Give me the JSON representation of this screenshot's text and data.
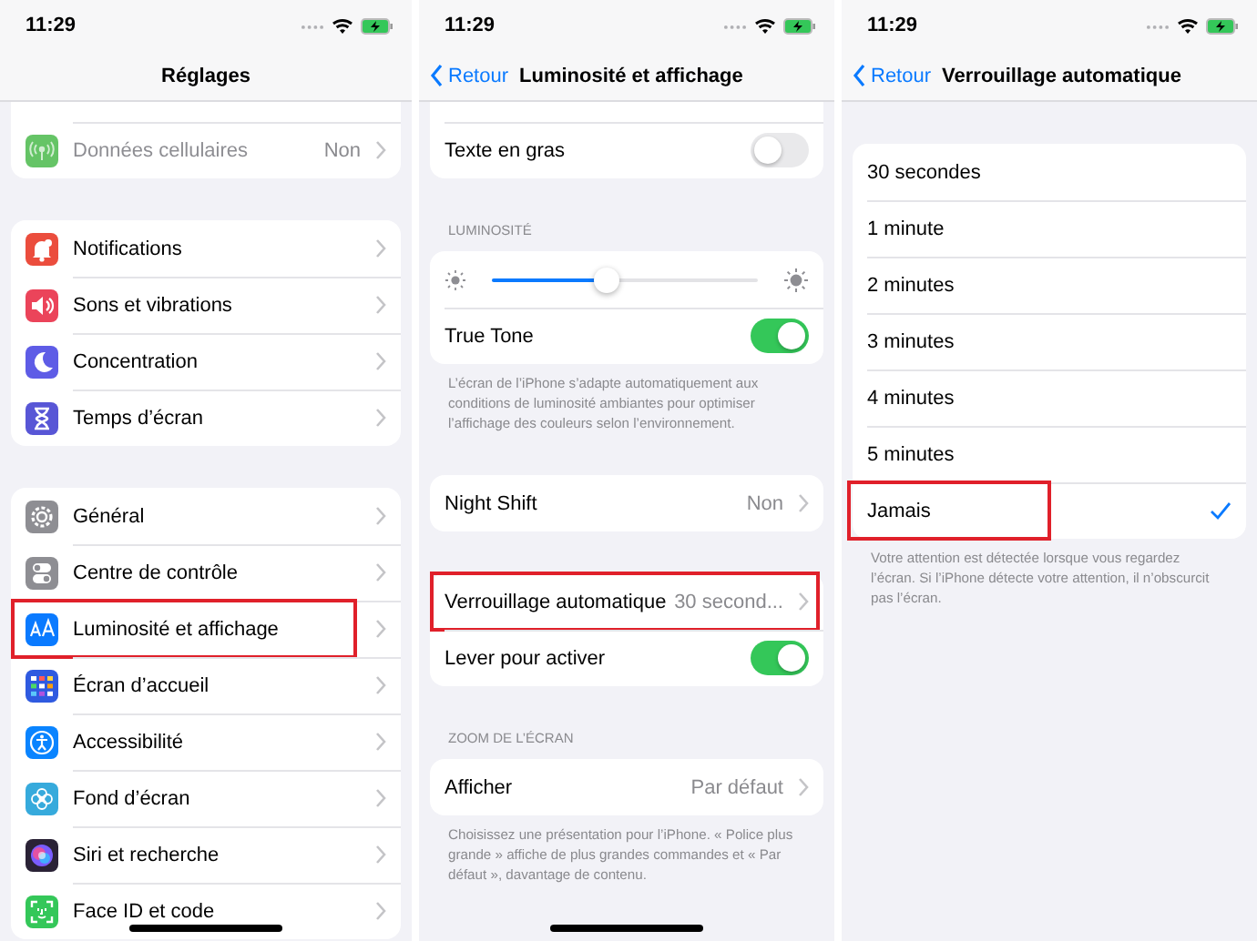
{
  "panels": [
    {
      "status_bar": {
        "time": "11:29"
      },
      "nav": {
        "title": "Réglages"
      },
      "home_indicator": true,
      "sections": [
        {
          "cut_top": true,
          "rows": [
            {
              "kind": "link",
              "label": "Données cellulaires",
              "value": "Non",
              "color": "#65c466",
              "disabled": true,
              "highlighted": false
            }
          ]
        },
        {
          "rows": [
            {
              "kind": "link",
              "label": "Notifications",
              "color": "#eb4d3d",
              "disabled": false,
              "highlighted": false
            },
            {
              "kind": "link",
              "label": "Sons et vibrations",
              "color": "#eb445a",
              "disabled": false,
              "highlighted": false
            },
            {
              "kind": "link",
              "label": "Concentration",
              "color": "#5e5ce6",
              "disabled": false,
              "highlighted": false
            },
            {
              "kind": "link",
              "label": "Temps d’écran",
              "color": "#5856d6",
              "disabled": false,
              "highlighted": false
            }
          ]
        },
        {
          "rows": [
            {
              "kind": "link",
              "label": "Général",
              "color": "#8e8e93",
              "disabled": false,
              "highlighted": false
            },
            {
              "kind": "link",
              "label": "Centre de contrôle",
              "color": "#8e8e93",
              "disabled": false,
              "highlighted": false
            },
            {
              "kind": "link",
              "label": "Luminosité et affichage",
              "color": "#0a7aff",
              "disabled": false,
              "highlighted": true
            },
            {
              "kind": "link",
              "label": "Écran d’accueil",
              "color": "#2f5ae0",
              "disabled": false,
              "highlighted": false
            },
            {
              "kind": "link",
              "label": "Accessibilité",
              "color": "#0a84ff",
              "disabled": false,
              "highlighted": false
            },
            {
              "kind": "link",
              "label": "Fond d’écran",
              "color": "#36aadc",
              "disabled": false,
              "highlighted": false
            },
            {
              "kind": "link",
              "label": "Siri et recherche",
              "color": "#2a2236",
              "disabled": false,
              "highlighted": false
            },
            {
              "kind": "link",
              "label": "Face ID et code",
              "color": "#34c759",
              "disabled": false,
              "highlighted": false
            }
          ]
        }
      ]
    },
    {
      "status_bar": {
        "time": "11:29"
      },
      "nav": {
        "back": "Retour",
        "title": "Luminosité et affichage"
      },
      "home_indicator": true,
      "sections": [
        {
          "cut_top": true,
          "rows": [
            {
              "kind": "toggle",
              "label": "Texte en gras",
              "on": false,
              "highlighted": false
            }
          ]
        },
        {
          "header": "LUMINOSITÉ",
          "rows": [
            {
              "kind": "slider",
              "level": 0.43
            },
            {
              "kind": "toggle",
              "label": "True Tone",
              "on": true,
              "highlighted": false
            }
          ],
          "footer": "L’écran de l’iPhone s’adapte automatiquement aux conditions de luminosité ambiantes pour optimiser l’affichage des couleurs selon l’environnement."
        },
        {
          "rows": [
            {
              "kind": "link",
              "label": "Night Shift",
              "value": "Non",
              "highlighted": false
            }
          ]
        },
        {
          "rows": [
            {
              "kind": "link",
              "label": "Verrouillage automatique",
              "value": "30 second...",
              "highlighted": true
            },
            {
              "kind": "toggle",
              "label": "Lever pour activer",
              "on": true,
              "highlighted": false
            }
          ]
        },
        {
          "header": "ZOOM DE L’ÉCRAN",
          "rows": [
            {
              "kind": "link",
              "label": "Afficher",
              "value": "Par défaut",
              "highlighted": false
            }
          ],
          "footer": "Choisissez une présentation pour l’iPhone. « Police plus grande » affiche de plus grandes commandes et « Par défaut », davantage de contenu."
        }
      ]
    },
    {
      "status_bar": {
        "time": "11:29"
      },
      "nav": {
        "back": "Retour",
        "title": "Verrouillage automatique"
      },
      "sections": [
        {
          "rows": [
            {
              "kind": "option",
              "label": "30 secondes",
              "selected": false,
              "highlighted": false
            },
            {
              "kind": "option",
              "label": "1 minute",
              "selected": false,
              "highlighted": false
            },
            {
              "kind": "option",
              "label": "2 minutes",
              "selected": false,
              "highlighted": false
            },
            {
              "kind": "option",
              "label": "3 minutes",
              "selected": false,
              "highlighted": false
            },
            {
              "kind": "option",
              "label": "4 minutes",
              "selected": false,
              "highlighted": false
            },
            {
              "kind": "option",
              "label": "5 minutes",
              "selected": false,
              "highlighted": false
            },
            {
              "kind": "option",
              "label": "Jamais",
              "selected": true,
              "highlighted": true
            }
          ],
          "footer": "Votre attention est détectée lorsque vous regardez l’écran. Si l’iPhone détecte votre attention, il n’obscurcit pas l’écran."
        }
      ]
    }
  ]
}
